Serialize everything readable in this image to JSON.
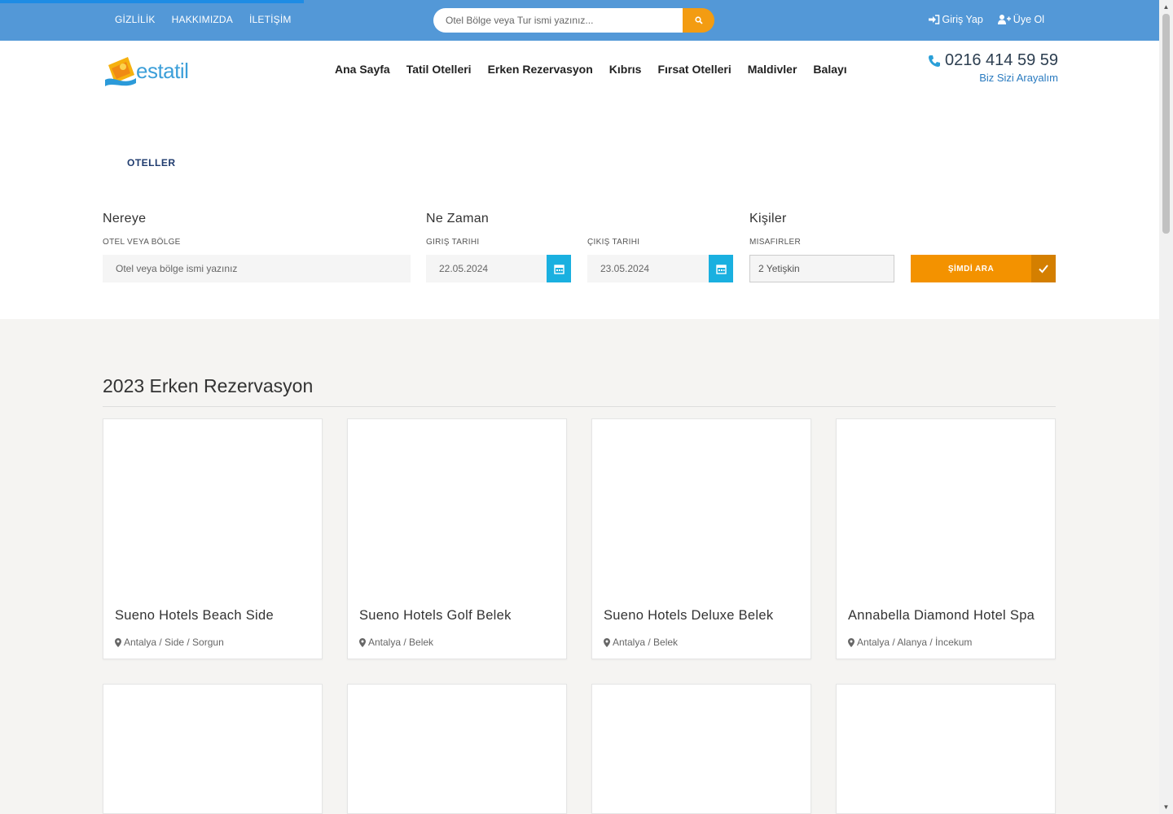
{
  "topbar": {
    "links": [
      "GİZLİLİK",
      "HAKKIMIZDA",
      "İLETİŞİM"
    ],
    "search_placeholder": "Otel Bölge veya Tur ismi yazınız...",
    "login": "Giriş Yap",
    "register": "Üye Ol"
  },
  "brand": {
    "logo_text": "estatil",
    "accent": "#5398d7",
    "orange": "#f39200"
  },
  "nav": [
    "Ana Sayfa",
    "Tatil Otelleri",
    "Erken Rezervasyon",
    "Kıbrıs",
    "Fırsat Otelleri",
    "Maldivler",
    "Balayı"
  ],
  "contact": {
    "phone": "0216 414 59 59",
    "callback": "Biz Sizi Arayalım"
  },
  "breadcrumb": "OTELLER",
  "search": {
    "where_title": "Nereye",
    "where_label": "OTEL VEYA BÖLGE",
    "where_placeholder": "Otel veya bölge ismi yazınız",
    "when_title": "Ne Zaman",
    "checkin_label": "GIRIŞ TARIHI",
    "checkin_value": "22.05.2024",
    "checkout_label": "ÇIKIŞ TARIHI",
    "checkout_value": "23.05.2024",
    "who_title": "Kişiler",
    "guests_label": "MISAFIRLER",
    "guests_value": "2 Yetişkin",
    "button": "ŞİMDİ ARA"
  },
  "section_title": "2023 Erken Rezervasyon",
  "hotels": [
    {
      "name": "Sueno Hotels Beach Side",
      "location": "Antalya / Side / Sorgun"
    },
    {
      "name": "Sueno Hotels Golf Belek",
      "location": "Antalya / Belek"
    },
    {
      "name": "Sueno Hotels Deluxe Belek",
      "location": "Antalya / Belek"
    },
    {
      "name": "Annabella Diamond Hotel Spa",
      "location": "Antalya / Alanya / İncekum"
    }
  ]
}
